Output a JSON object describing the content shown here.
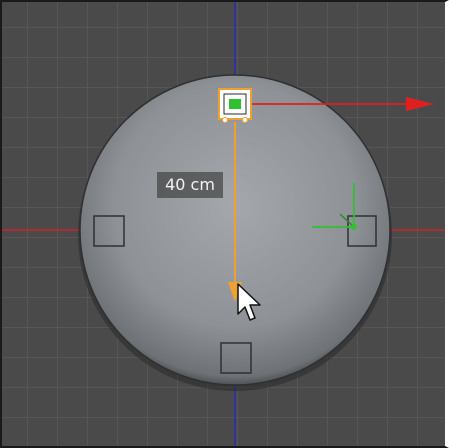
{
  "viewport": {
    "name": "3d-viewport",
    "background_color": "#4a4a4a",
    "grid_color": "#5c5c5c",
    "axis_x_color": "#c8242a",
    "axis_y_color": "#2828b4"
  },
  "object": {
    "shape": "disc",
    "fill_color": "#8c9094",
    "handles": [
      "top-handle",
      "left-handle",
      "right-handle",
      "bottom-handle"
    ]
  },
  "measurement": {
    "label": "40 cm",
    "line_color": "#f0a030"
  },
  "gizmo": {
    "x_arrow_color": "#e02020",
    "y_arrow_color": "#30c030",
    "pivot_color": "#30c030",
    "icons": [
      "move-x-arrow-icon",
      "axis-gizmo-icon",
      "mouse-cursor-icon"
    ]
  }
}
